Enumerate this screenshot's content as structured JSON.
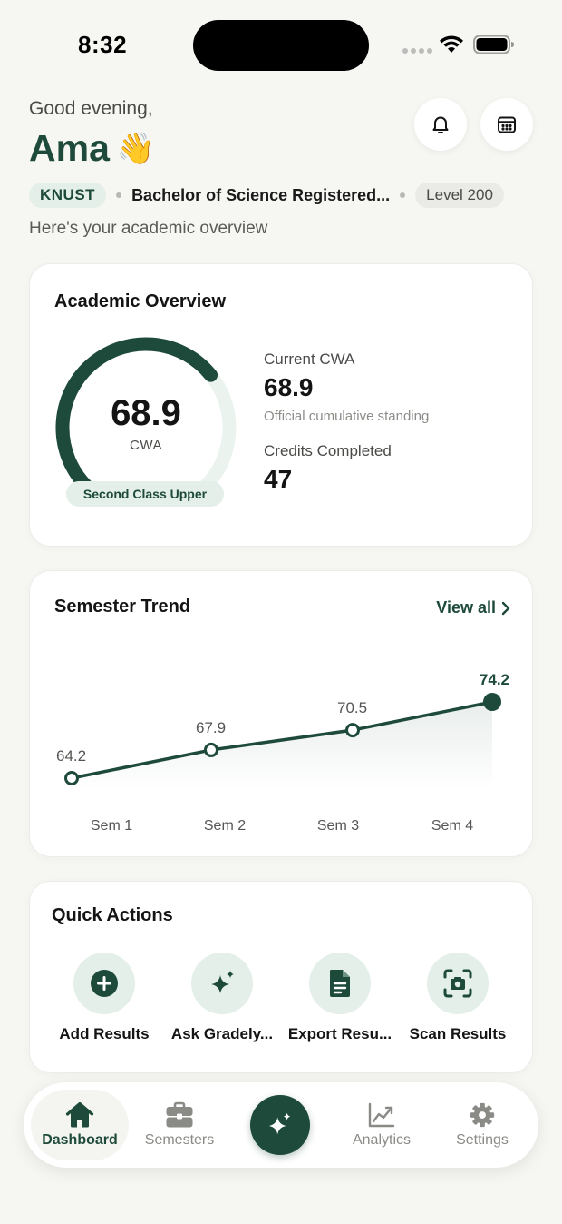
{
  "status_bar": {
    "time": "8:32"
  },
  "header": {
    "greeting": "Good evening,",
    "name": "Ama",
    "wave": "👋",
    "school": "KNUST",
    "program": "Bachelor of Science Registered...",
    "level": "Level 200",
    "subtitle": "Here's your academic overview"
  },
  "overview": {
    "title": "Academic Overview",
    "gauge_value": "68.9",
    "gauge_unit": "CWA",
    "gauge_fraction": 0.689,
    "classification": "Second Class Upper",
    "current_label": "Current CWA",
    "current_value": "68.9",
    "current_note": "Official cumulative standing",
    "credits_label": "Credits Completed",
    "credits_value": "47"
  },
  "trend": {
    "title": "Semester Trend",
    "view_all": "View all"
  },
  "chart_data": {
    "type": "line",
    "categories": [
      "Sem 1",
      "Sem 2",
      "Sem 3",
      "Sem 4"
    ],
    "values": [
      64.2,
      67.9,
      70.5,
      74.2
    ],
    "value_labels": [
      "64.2",
      "67.9",
      "70.5",
      "74.2"
    ],
    "ylim": [
      64.2,
      74.2
    ],
    "grid": false,
    "legend": "none"
  },
  "quick_actions": {
    "title": "Quick Actions",
    "items": [
      {
        "label": "Add Results",
        "icon": "plus-circle-icon"
      },
      {
        "label": "Ask Gradely...",
        "icon": "sparkles-icon"
      },
      {
        "label": "Export Resu...",
        "icon": "document-icon"
      },
      {
        "label": "Scan Results",
        "icon": "scan-camera-icon"
      }
    ]
  },
  "nav": {
    "items": [
      {
        "label": "Dashboard",
        "icon": "home-icon",
        "active": true
      },
      {
        "label": "Semesters",
        "icon": "briefcase-icon",
        "active": false
      },
      {
        "label": "Analytics",
        "icon": "chart-icon",
        "active": false
      },
      {
        "label": "Settings",
        "icon": "gear-icon",
        "active": false
      }
    ],
    "fab_icon": "sparkles-icon"
  },
  "colors": {
    "brand": "#1d4a3a",
    "brand_light": "#e3efe8",
    "background": "#f6f6f2"
  }
}
